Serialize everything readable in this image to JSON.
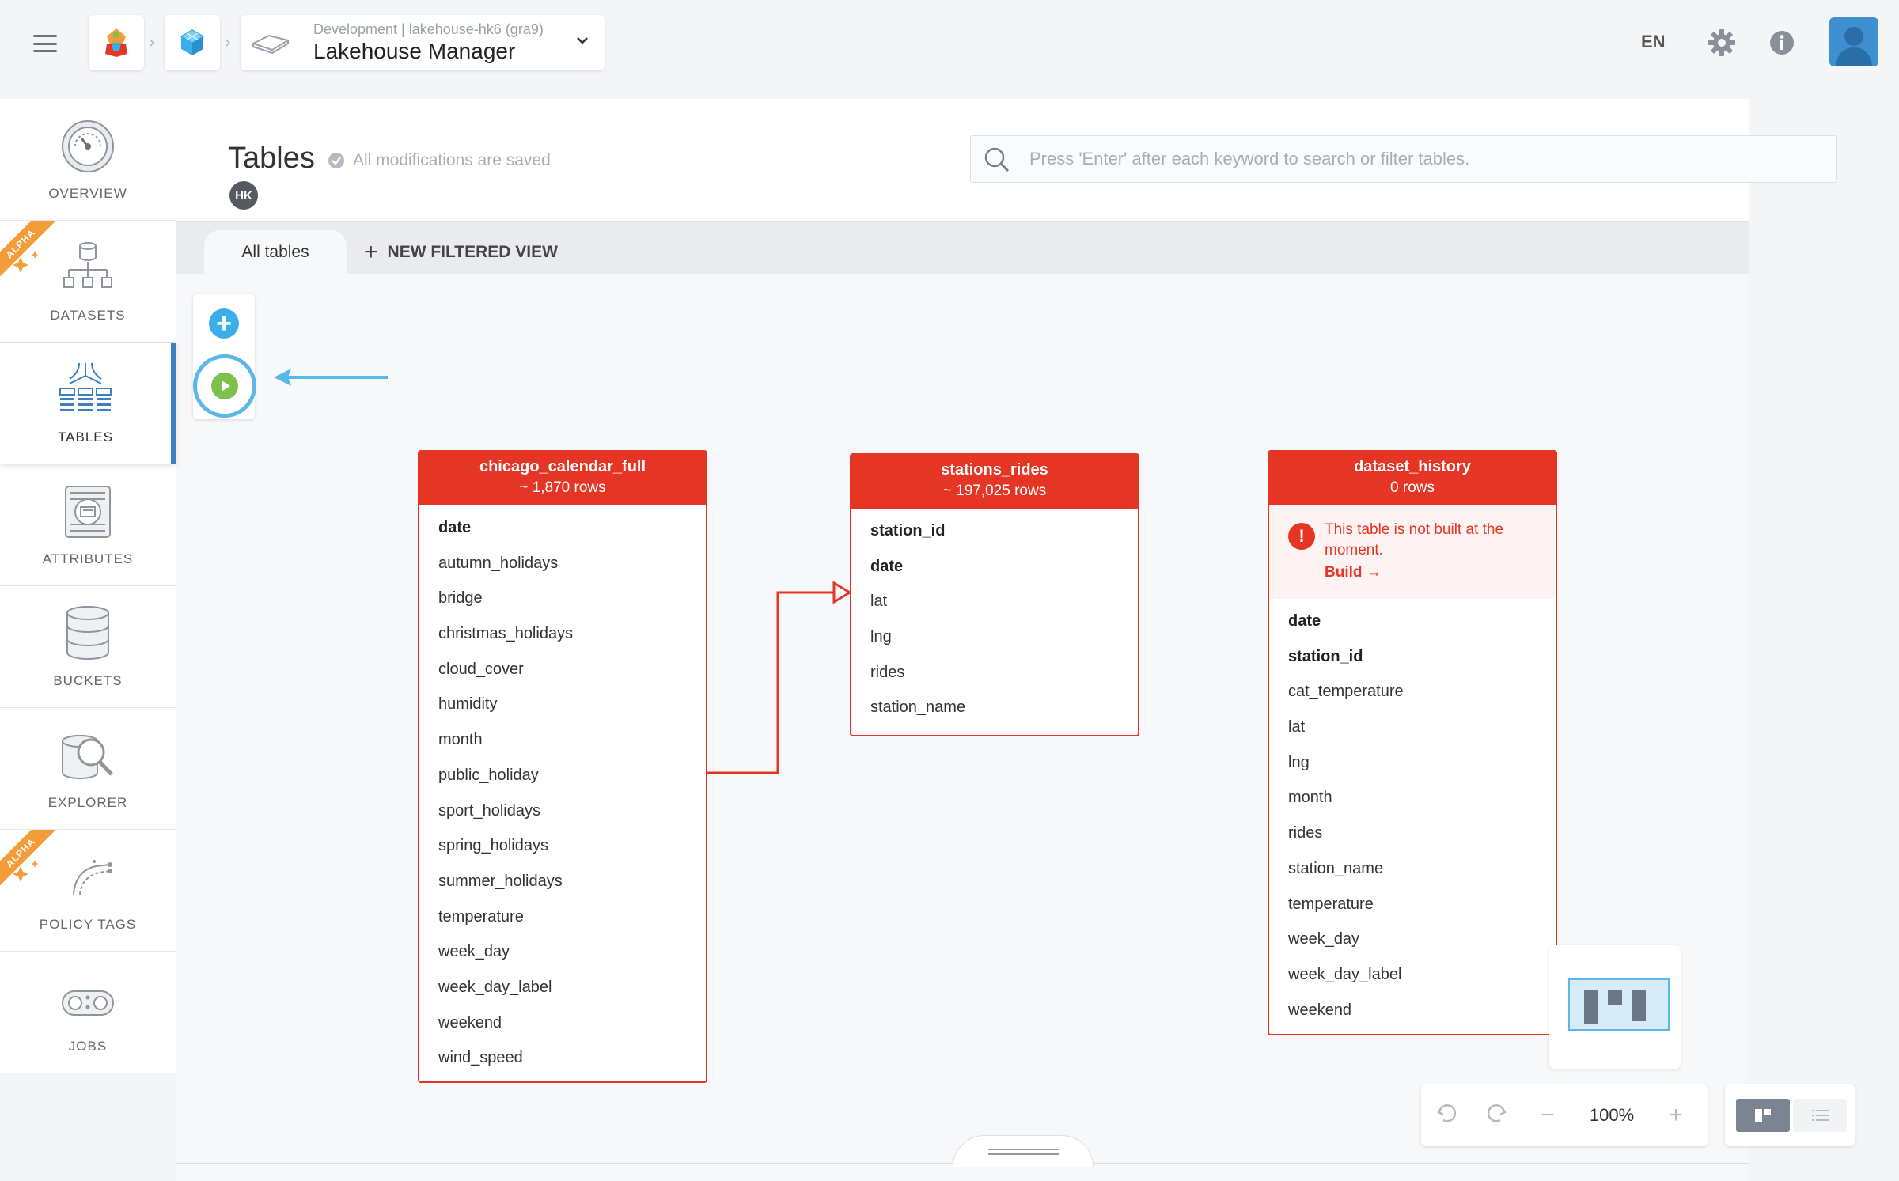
{
  "topbar": {
    "project_sub": "Development | lakehouse-hk6 (gra9)",
    "project_title": "Lakehouse Manager",
    "lang": "EN"
  },
  "sidebar": {
    "items": [
      {
        "label": "OVERVIEW",
        "icon": "gauge-icon"
      },
      {
        "label": "DATASETS",
        "icon": "datasets-tree-icon",
        "badge": "ALPHA"
      },
      {
        "label": "TABLES",
        "icon": "tables-icon",
        "active": true
      },
      {
        "label": "ATTRIBUTES",
        "icon": "attributes-icon"
      },
      {
        "label": "BUCKETS",
        "icon": "buckets-database-icon"
      },
      {
        "label": "EXPLORER",
        "icon": "explorer-magnifier-icon"
      },
      {
        "label": "POLICY TAGS",
        "icon": "policy-tags-icon",
        "badge": "ALPHA"
      },
      {
        "label": "JOBS",
        "icon": "jobs-conveyor-icon"
      }
    ]
  },
  "header": {
    "title": "Tables",
    "saved_status": "All modifications are saved",
    "user_badge": "HK",
    "search_placeholder": "Press 'Enter' after each keyword to search or filter tables."
  },
  "tabs": {
    "all_tables": "All tables",
    "new_filtered_view": "NEW FILTERED VIEW"
  },
  "tables": [
    {
      "name": "chicago_calendar_full",
      "rows": "~ 1,870 rows",
      "columns": [
        {
          "name": "date",
          "key": true
        },
        {
          "name": "autumn_holidays"
        },
        {
          "name": "bridge"
        },
        {
          "name": "christmas_holidays"
        },
        {
          "name": "cloud_cover"
        },
        {
          "name": "humidity"
        },
        {
          "name": "month"
        },
        {
          "name": "public_holiday"
        },
        {
          "name": "sport_holidays"
        },
        {
          "name": "spring_holidays"
        },
        {
          "name": "summer_holidays"
        },
        {
          "name": "temperature"
        },
        {
          "name": "week_day"
        },
        {
          "name": "week_day_label"
        },
        {
          "name": "weekend"
        },
        {
          "name": "wind_speed"
        }
      ]
    },
    {
      "name": "stations_rides",
      "rows": "~ 197,025 rows",
      "columns": [
        {
          "name": "station_id",
          "key": true
        },
        {
          "name": "date",
          "key": true
        },
        {
          "name": "lat"
        },
        {
          "name": "lng"
        },
        {
          "name": "rides"
        },
        {
          "name": "station_name"
        }
      ]
    },
    {
      "name": "dataset_history",
      "rows": "0 rows",
      "warning": "This table is not built at the moment.",
      "warning_link": "Build →",
      "columns": [
        {
          "name": "date",
          "key": true
        },
        {
          "name": "station_id",
          "key": true
        },
        {
          "name": "cat_temperature"
        },
        {
          "name": "lat"
        },
        {
          "name": "lng"
        },
        {
          "name": "month"
        },
        {
          "name": "rides"
        },
        {
          "name": "station_name"
        },
        {
          "name": "temperature"
        },
        {
          "name": "week_day"
        },
        {
          "name": "week_day_label"
        },
        {
          "name": "weekend"
        }
      ]
    }
  ],
  "zoom": {
    "value": "100%"
  },
  "colors": {
    "table_header": "#e53525",
    "accent_blue": "#3d7fc1",
    "run_green": "#7cc14a",
    "highlight_ring": "#5ab8e8",
    "alpha_badge": "#f39c38"
  }
}
